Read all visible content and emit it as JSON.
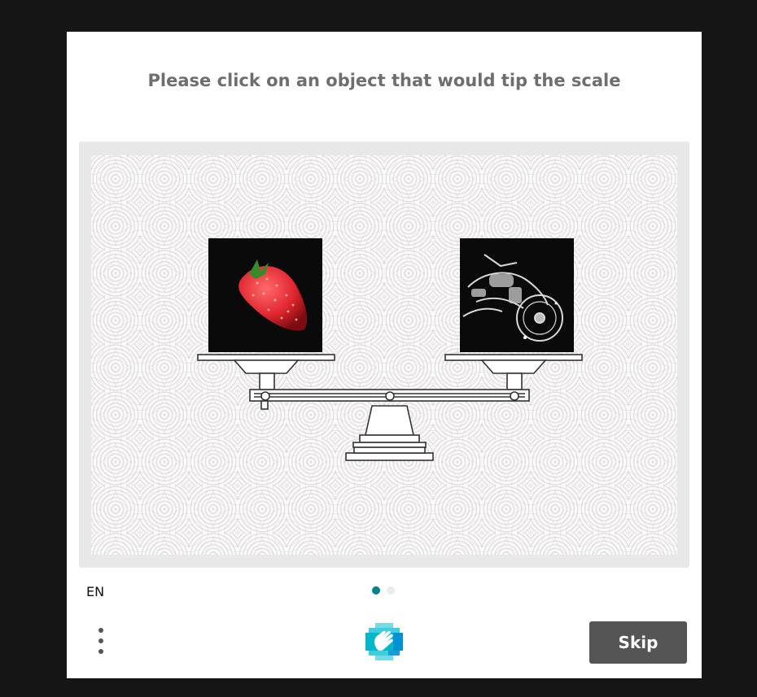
{
  "challenge": {
    "prompt": "Please click on an object that would tip the scale",
    "left_object": "strawberry",
    "right_object": "motorcycle"
  },
  "footer": {
    "language": "EN",
    "pages": [
      {
        "active": true
      },
      {
        "active": false
      }
    ],
    "skip_label": "Skip",
    "menu_icon": "kebab-menu-icon",
    "logo_icon": "hand-logo-icon"
  },
  "colors": {
    "page_background": "#151515",
    "modal_background": "#ffffff",
    "prompt_text": "#6e6e6e",
    "active_dot": "#00838f",
    "skip_button": "#555555",
    "logo_primary": "#00bcd4"
  }
}
